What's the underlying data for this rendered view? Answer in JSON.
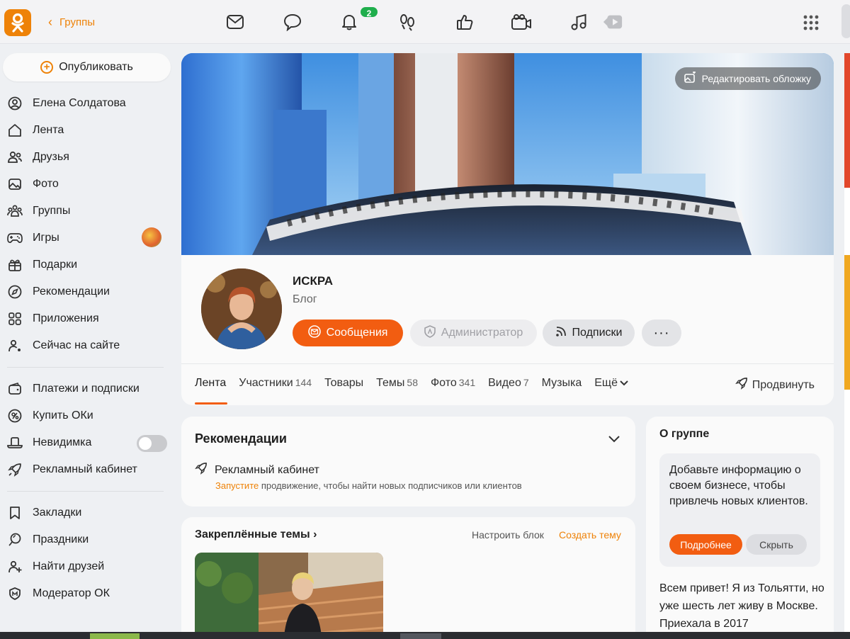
{
  "topbar": {
    "back_label": "Группы",
    "notifications_count": "2",
    "icons": [
      "messages-icon",
      "discussions-icon",
      "notifications-icon",
      "guests-icon",
      "likes-icon",
      "video-call-icon",
      "music-icon",
      "video-icon",
      "apps-grid-icon"
    ]
  },
  "sidebar": {
    "publish_label": "Опубликовать",
    "items": [
      {
        "label": "Елена Солдатова",
        "icon": "profile-icon"
      },
      {
        "label": "Лента",
        "icon": "home-icon"
      },
      {
        "label": "Друзья",
        "icon": "friends-icon"
      },
      {
        "label": "Фото",
        "icon": "photo-icon"
      },
      {
        "label": "Группы",
        "icon": "groups-icon"
      },
      {
        "label": "Игры",
        "icon": "games-icon"
      },
      {
        "label": "Подарки",
        "icon": "gift-icon"
      },
      {
        "label": "Рекомендации",
        "icon": "compass-icon"
      },
      {
        "label": "Приложения",
        "icon": "apps-icon"
      },
      {
        "label": "Сейчас на сайте",
        "icon": "online-icon"
      }
    ],
    "items2": [
      {
        "label": "Платежи и подписки",
        "icon": "wallet-icon"
      },
      {
        "label": "Купить ОКи",
        "icon": "coins-icon"
      },
      {
        "label": "Невидимка",
        "icon": "invisible-hat-icon"
      },
      {
        "label": "Рекламный кабинет",
        "icon": "rocket-icon"
      }
    ],
    "items3": [
      {
        "label": "Закладки",
        "icon": "bookmark-icon"
      },
      {
        "label": "Праздники",
        "icon": "holiday-icon"
      },
      {
        "label": "Найти друзей",
        "icon": "add-friend-icon"
      },
      {
        "label": "Модератор ОК",
        "icon": "moderator-icon"
      }
    ],
    "invisible_toggle_on": false
  },
  "group": {
    "edit_cover_label": "Редактировать обложку",
    "name": "ИСКРА",
    "type": "Блог",
    "messages_button": "Сообщения",
    "admin_button": "Администратор",
    "subscriptions_button": "Подписки",
    "more_button": "···",
    "tabs": [
      {
        "label": "Лента",
        "count": ""
      },
      {
        "label": "Участники",
        "count": "144"
      },
      {
        "label": "Товары",
        "count": ""
      },
      {
        "label": "Темы",
        "count": "58"
      },
      {
        "label": "Фото",
        "count": "341"
      },
      {
        "label": "Видео",
        "count": "7"
      },
      {
        "label": "Музыка",
        "count": ""
      },
      {
        "label": "Ещё",
        "count": ""
      }
    ],
    "active_tab": "Лента",
    "promote_label": "Продвинуть"
  },
  "recommendations": {
    "title": "Рекомендации",
    "item_label": "Рекламный кабинет",
    "sub_link": "Запустите",
    "sub_text": " продвижение, чтобы найти новых подписчиков или клиентов"
  },
  "pinned": {
    "title": "Закреплённые темы",
    "configure": "Настроить блок",
    "create": "Создать тему"
  },
  "about": {
    "title": "О группе",
    "prompt": "Добавьте информацию о своем бизнесе, чтобы привлечь новых клиентов.",
    "more_button": "Подробнее",
    "hide_button": "Скрыть",
    "description": "Всем привет! Я из Тольятти, но уже шесть лет живу в Москве. Приехала в 2017"
  },
  "colors": {
    "accent": "#f25d11",
    "brand": "#ee8208",
    "badge": "#1fae4c"
  }
}
